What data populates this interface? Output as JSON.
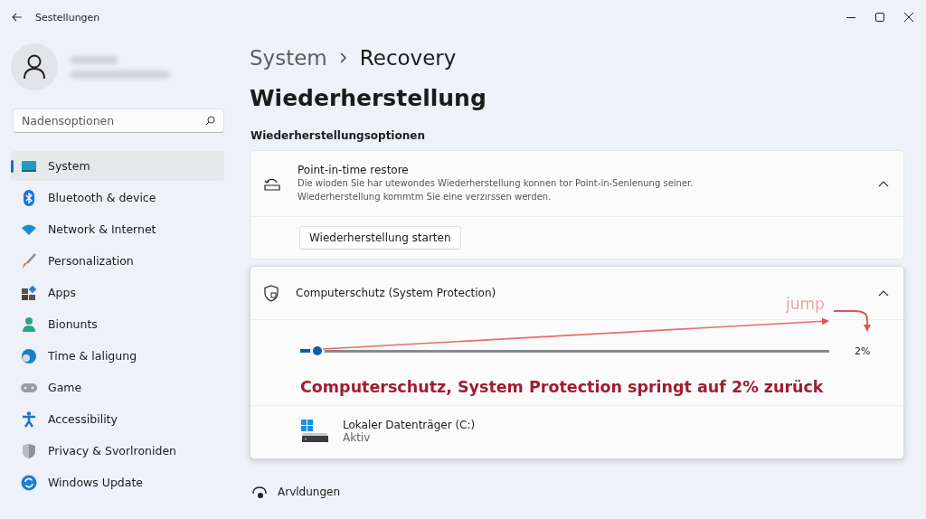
{
  "window": {
    "title": "Sestellungen"
  },
  "sidebar": {
    "search": {
      "placeholder": "Nadensoptionen"
    },
    "items": [
      {
        "label": "System",
        "selected": true
      },
      {
        "label": "Bluetooth & device",
        "selected": false
      },
      {
        "label": "Network & Internet",
        "selected": false
      },
      {
        "label": "Personalization",
        "selected": false
      },
      {
        "label": "Apps",
        "selected": false
      },
      {
        "label": "Bionunts",
        "selected": false
      },
      {
        "label": "Time & laligung",
        "selected": false
      },
      {
        "label": "Game",
        "selected": false
      },
      {
        "label": "Accessibility",
        "selected": false
      },
      {
        "label": "Privacy & Svorlroniden",
        "selected": false
      },
      {
        "label": "Windows Update",
        "selected": false
      }
    ]
  },
  "breadcrumb": [
    "System",
    "Recovery"
  ],
  "page_title": "Wiederherstellung",
  "section_heading": "Wiederherstellungsoptionen",
  "restore_card": {
    "title": "Point-in-time restore",
    "description": "Die wioden Sie har utewondes Wiederherstellung konnen tor Point-in-Senlenung seiner. Wiederherstellung kommtm Sie eine verzırssen werden.",
    "expanded": true,
    "button": "Wiederherstellung starten"
  },
  "protection_card": {
    "title": "Computerschutz (System Protection)",
    "expanded": true,
    "slider": {
      "level": 0.02,
      "reading": "2%"
    },
    "annotation": {
      "label": "jump",
      "caption": "Computerschutz, System Protection springt auf 2% zurück"
    },
    "drive": {
      "name": "Lokaler Datenträger (C:)",
      "status": "Aktiv"
    }
  },
  "bottom_link": "Arvldungen"
}
